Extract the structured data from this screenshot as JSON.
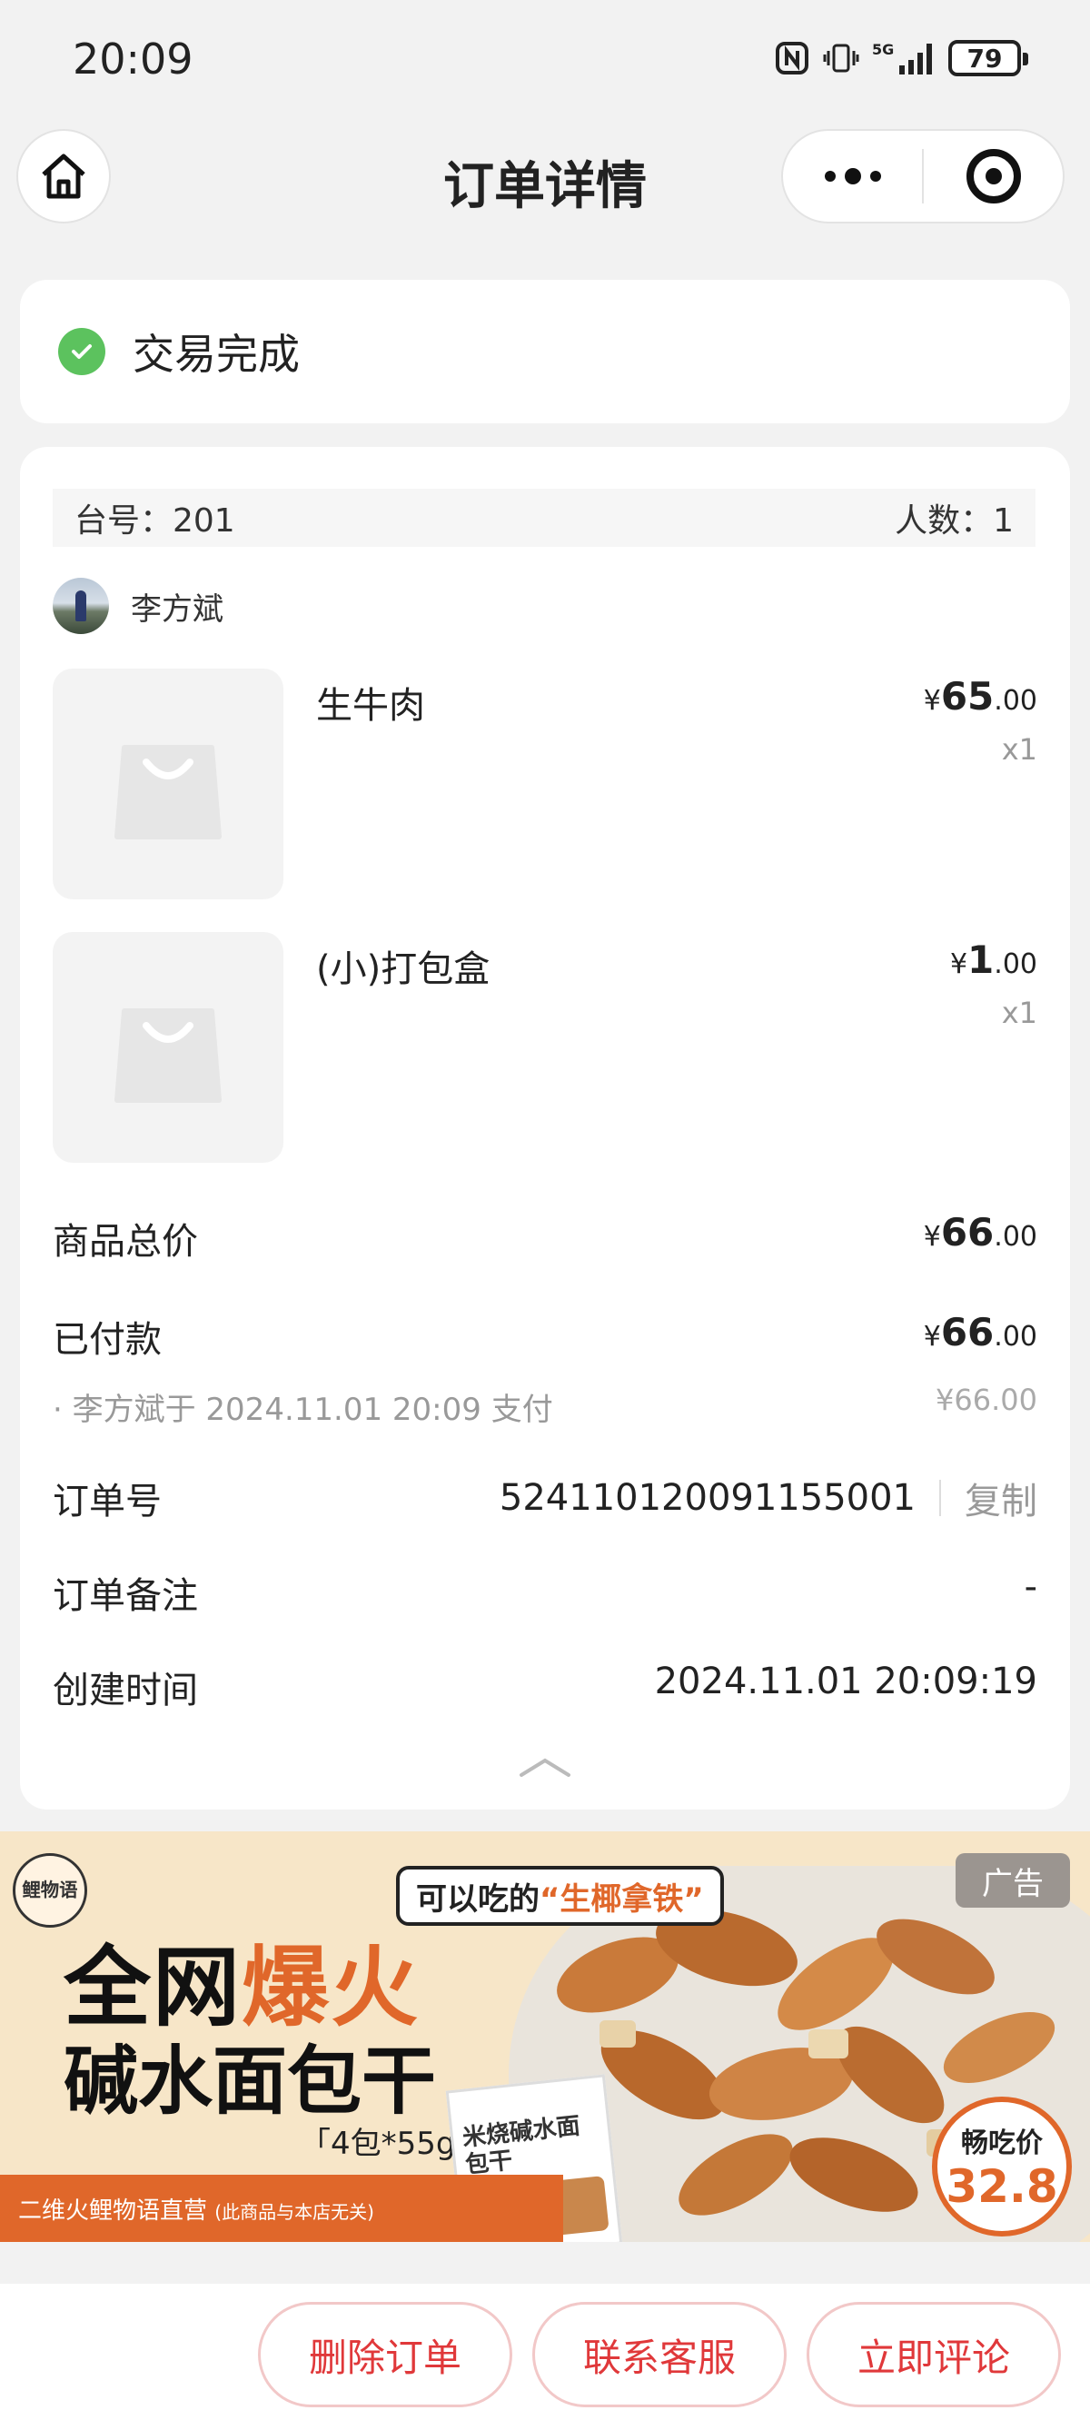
{
  "status_bar": {
    "time": "20:09",
    "battery": "79",
    "network": "5G"
  },
  "nav": {
    "title": "订单详情",
    "home_icon": "home-icon",
    "more_icon": "more-dots-icon",
    "close_icon": "target-icon"
  },
  "order_status": {
    "text": "交易完成",
    "color": "#5cc25e"
  },
  "table": {
    "table_no": "台号：201",
    "people": "人数：1"
  },
  "user": {
    "name": "李方斌"
  },
  "items": [
    {
      "name": "生牛肉",
      "currency": "¥",
      "price_int": "65",
      "price_dec": ".00",
      "qty": "x1"
    },
    {
      "name": "(小)打包盒",
      "currency": "¥",
      "price_int": "1",
      "price_dec": ".00",
      "qty": "x1"
    }
  ],
  "summary": {
    "total_label": "商品总价",
    "total_currency": "¥",
    "total_int": "66",
    "total_dec": ".00",
    "paid_label": "已付款",
    "paid_currency": "¥",
    "paid_int": "66",
    "paid_dec": ".00",
    "pay_note": "· 李方斌于 2024.11.01 20:09 支付",
    "pay_note_amount": "¥66.00"
  },
  "details": {
    "order_no_label": "订单号",
    "order_no": "524110120091155001",
    "copy": "复制",
    "remark_label": "订单备注",
    "remark": "-",
    "created_label": "创建时间",
    "created": "2024.11.01 20:09:19"
  },
  "ad": {
    "logo": "鲤物语",
    "headline_a": "全网",
    "headline_hot": "爆火",
    "headline_2": "碱水面包干",
    "pack": "「4包*55g」",
    "bubble_a": "可以吃的",
    "bubble_hl": "“生椰拿铁”",
    "tag": "广告",
    "price_label": "畅吃价",
    "price": "32.8",
    "bag_text": "米烧碱水面包干",
    "footer": "二维火鲤物语直营",
    "footer_small": "(此商品与本店无关)",
    "accent": "#e0672a"
  },
  "actions": {
    "delete": "删除订单",
    "contact": "联系客服",
    "review": "立即评论",
    "accent": "#e0383a"
  }
}
